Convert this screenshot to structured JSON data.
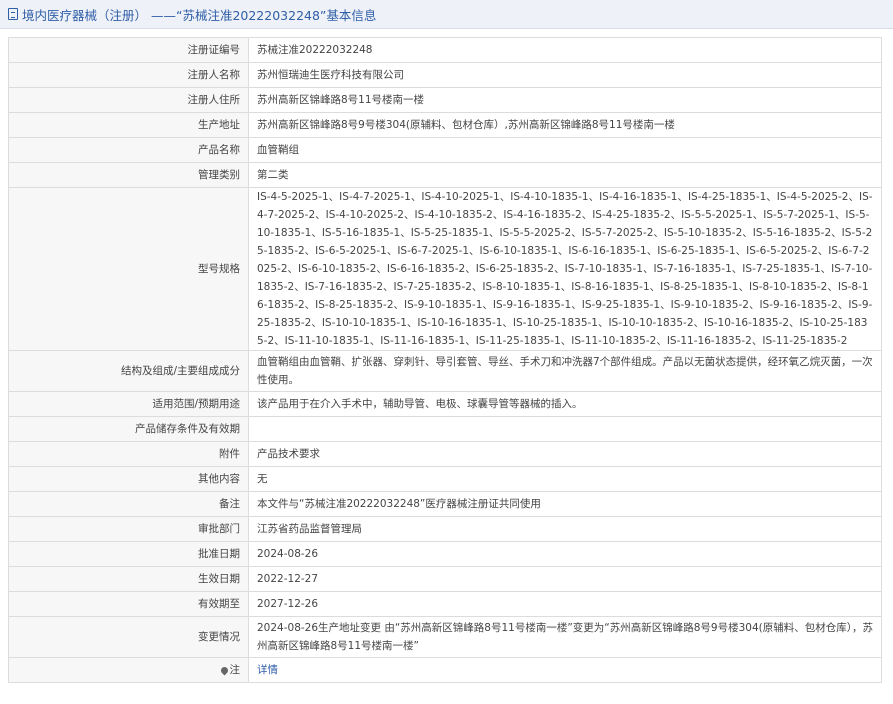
{
  "header": {
    "title": "境内医疗器械（注册） ——“苏械注准20222032248”基本信息"
  },
  "rows": [
    {
      "label": "注册证编号",
      "value": "苏械注准20222032248"
    },
    {
      "label": "注册人名称",
      "value": "苏州恒瑞迪生医疗科技有限公司"
    },
    {
      "label": "注册人住所",
      "value": "苏州高新区锦峰路8号11号楼南一楼"
    },
    {
      "label": "生产地址",
      "value": "苏州高新区锦峰路8号9号楼304(原辅料、包材仓库）,苏州高新区锦峰路8号11号楼南一楼"
    },
    {
      "label": "产品名称",
      "value": "血管鞘组"
    },
    {
      "label": "管理类别",
      "value": "第二类"
    },
    {
      "label": "型号规格",
      "value": "IS-4-5-2025-1、IS-4-7-2025-1、IS-4-10-2025-1、IS-4-10-1835-1、IS-4-16-1835-1、IS-4-25-1835-1、IS-4-5-2025-2、IS-4-7-2025-2、IS-4-10-2025-2、IS-4-10-1835-2、IS-4-16-1835-2、IS-4-25-1835-2、IS-5-5-2025-1、IS-5-7-2025-1、IS-5-10-1835-1、IS-5-16-1835-1、IS-5-25-1835-1、IS-5-5-2025-2、IS-5-7-2025-2、IS-5-10-1835-2、IS-5-16-1835-2、IS-5-25-1835-2、IS-6-5-2025-1、IS-6-7-2025-1、IS-6-10-1835-1、IS-6-16-1835-1、IS-6-25-1835-1、IS-6-5-2025-2、IS-6-7-2025-2、IS-6-10-1835-2、IS-6-16-1835-2、IS-6-25-1835-2、IS-7-10-1835-1、IS-7-16-1835-1、IS-7-25-1835-1、IS-7-10-1835-2、IS-7-16-1835-2、IS-7-25-1835-2、IS-8-10-1835-1、IS-8-16-1835-1、IS-8-25-1835-1、IS-8-10-1835-2、IS-8-16-1835-2、IS-8-25-1835-2、IS-9-10-1835-1、IS-9-16-1835-1、IS-9-25-1835-1、IS-9-10-1835-2、IS-9-16-1835-2、IS-9-25-1835-2、IS-10-10-1835-1、IS-10-16-1835-1、IS-10-25-1835-1、IS-10-10-1835-2、IS-10-16-1835-2、IS-10-25-1835-2、IS-11-10-1835-1、IS-11-16-1835-1、IS-11-25-1835-1、IS-11-10-1835-2、IS-11-16-1835-2、IS-11-25-1835-2"
    },
    {
      "label": "结构及组成/主要组成成分",
      "value": "血管鞘组由血管鞘、扩张器、穿刺针、导引套管、导丝、手术刀和冲洗器7个部件组成。产品以无菌状态提供，经环氧乙烷灭菌，一次性使用。"
    },
    {
      "label": "适用范围/预期用途",
      "value": "该产品用于在介入手术中，辅助导管、电极、球囊导管等器械的插入。"
    },
    {
      "label": "产品储存条件及有效期",
      "value": ""
    },
    {
      "label": "附件",
      "value": "产品技术要求"
    },
    {
      "label": "其他内容",
      "value": "无"
    },
    {
      "label": "备注",
      "value": "本文件与“苏械注准20222032248”医疗器械注册证共同使用"
    },
    {
      "label": "审批部门",
      "value": "江苏省药品监督管理局"
    },
    {
      "label": "批准日期",
      "value": "2024-08-26"
    },
    {
      "label": "生效日期",
      "value": "2022-12-27"
    },
    {
      "label": "有效期至",
      "value": "2027-12-26"
    },
    {
      "label": "变更情况",
      "value": "2024-08-26生产地址变更 由“苏州高新区锦峰路8号11号楼南一楼”变更为“苏州高新区锦峰路8号9号楼304(原辅料、包材仓库），苏州高新区锦峰路8号11号楼南一楼”"
    }
  ],
  "note": {
    "label": "注",
    "link": "详情"
  },
  "colors": {
    "accent": "#2f5ea8",
    "header_bg": "#eef1f7",
    "label_bg": "#f7f7f7",
    "border": "#dcdcdc"
  }
}
